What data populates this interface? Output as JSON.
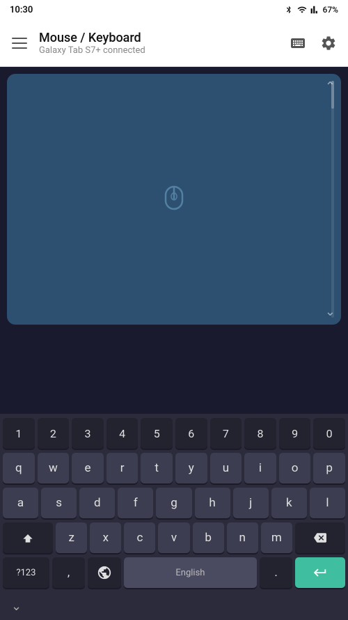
{
  "statusBar": {
    "time": "10:30",
    "batteryPercent": "67%"
  },
  "topBar": {
    "title": "Mouse / Keyboard",
    "subtitle": "Galaxy Tab S7+ connected"
  },
  "keyboard": {
    "row1": [
      "1",
      "2",
      "3",
      "4",
      "5",
      "6",
      "7",
      "8",
      "9",
      "0"
    ],
    "row2": [
      "q",
      "w",
      "e",
      "r",
      "t",
      "y",
      "u",
      "i",
      "o",
      "p"
    ],
    "row3": [
      "a",
      "s",
      "d",
      "f",
      "g",
      "h",
      "j",
      "k",
      "l"
    ],
    "row4": [
      "z",
      "x",
      "c",
      "v",
      "b",
      "n",
      "m"
    ],
    "symbolsLabel": "?123",
    "commaLabel": ",",
    "spaceLabel": "English",
    "periodLabel": ".",
    "chevronDownLabel": "∨"
  }
}
